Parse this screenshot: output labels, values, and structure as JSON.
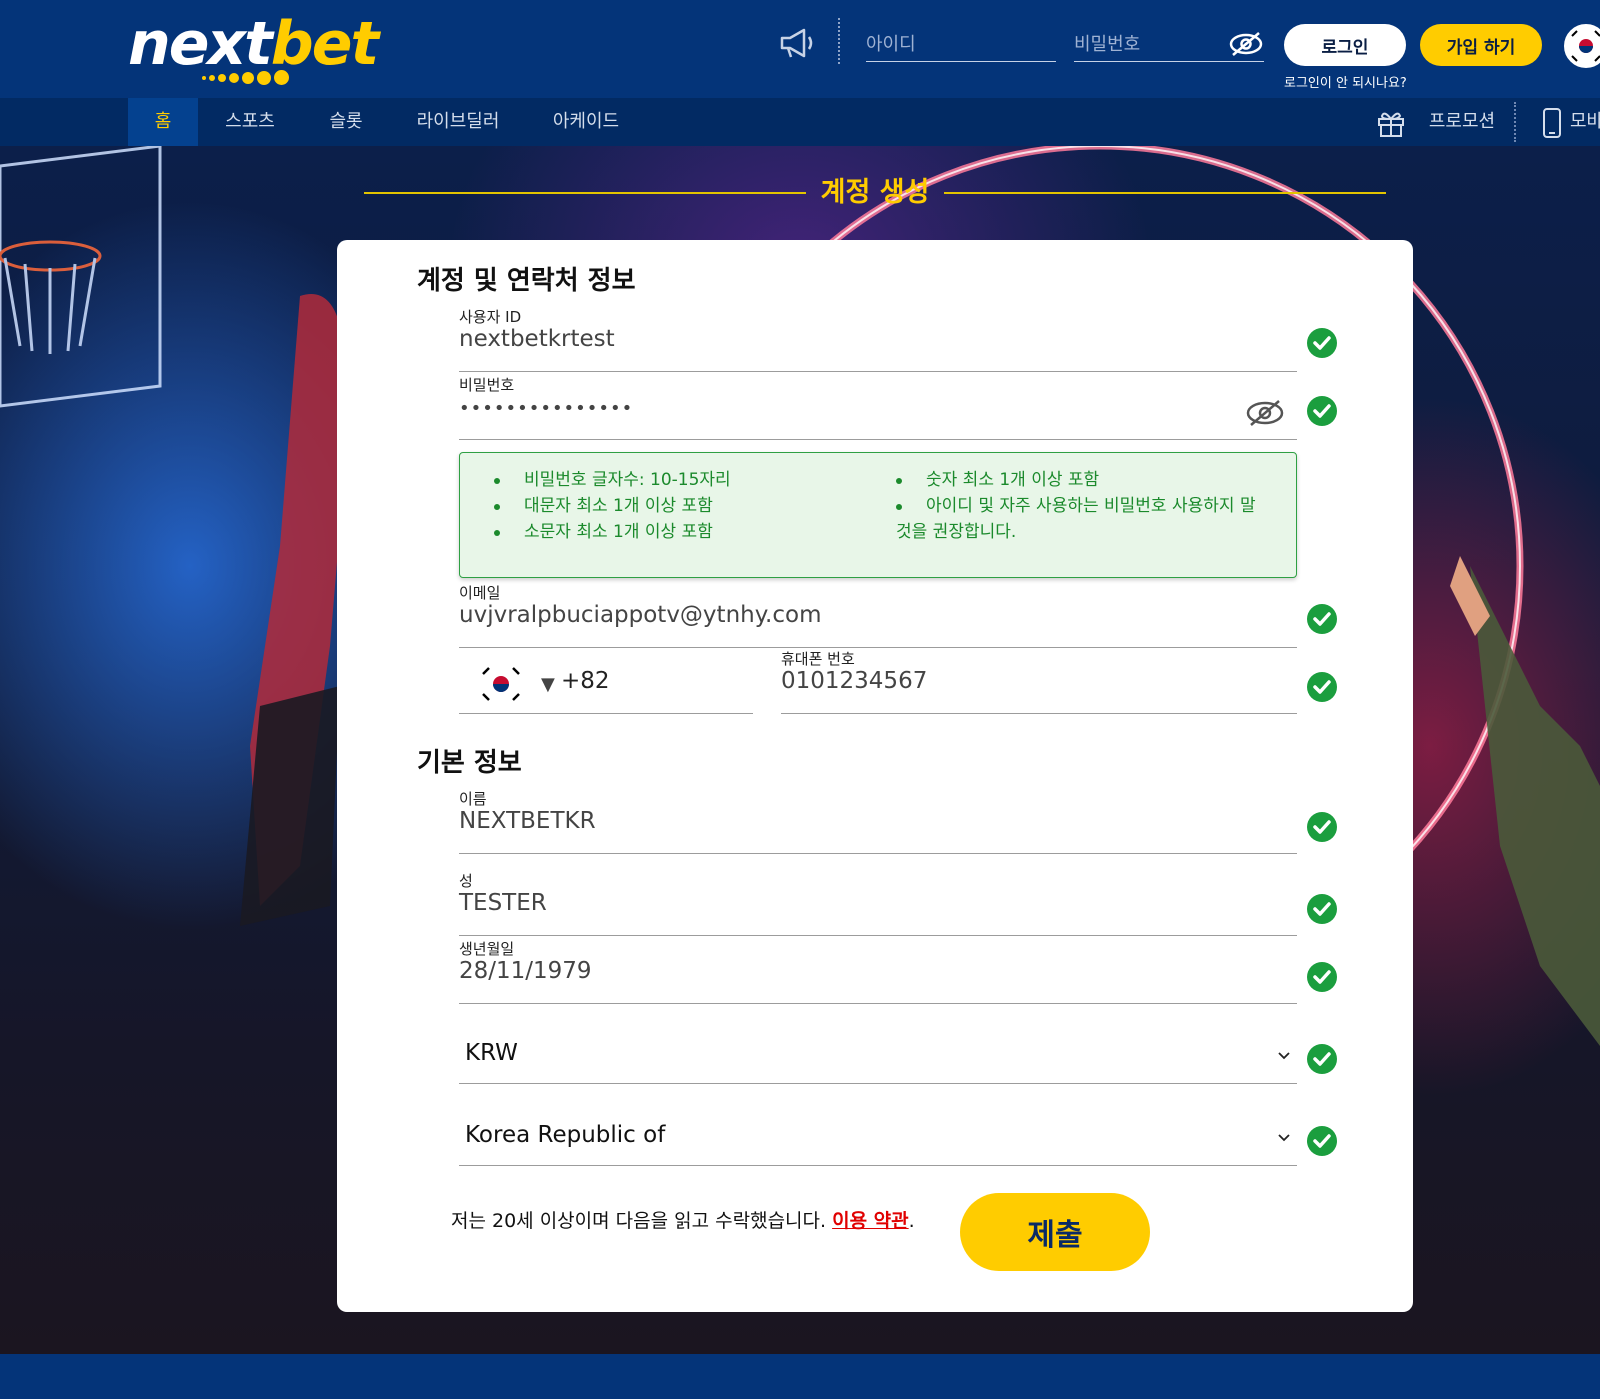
{
  "header": {
    "logo_next": "next",
    "logo_bet": "bet",
    "username_placeholder": "아이디",
    "password_placeholder": "비밀번호",
    "login_label": "로그인",
    "join_label": "가입 하기",
    "forgot_label": "로그인이 안 되시나요?"
  },
  "nav": {
    "items": [
      "홈",
      "스포츠",
      "슬롯",
      "라이브딜러",
      "아케이드"
    ],
    "promotion_label": "프로모션",
    "mobile_label": "모바"
  },
  "page": {
    "title": "계정 생성"
  },
  "account_section": {
    "title": "계정 및 연락처 정보",
    "user_id_label": "사용자 ID",
    "user_id_value": "nextbetkrtest",
    "password_label": "비밀번호",
    "password_value": "•••••••••••••••",
    "rules_col1": [
      "비밀번호 글자수: 10-15자리",
      "대문자 최소 1개 이상 포함",
      "소문자 최소 1개 이상 포함"
    ],
    "rules_col2_item1": "숫자 최소 1개 이상 포함",
    "rules_col2_item2_line1": "아이디 및 자주 사용하는 비밀번호 사용하지 말",
    "rules_col2_item2_line2": "것을 권장합니다.",
    "email_label": "이메일",
    "email_value": "uvjvralpbuciappotv@ytnhy.com",
    "phone_prefix": "+82",
    "phone_arrow": "▼",
    "phone_label": "휴대폰 번호",
    "phone_value": "0101234567"
  },
  "basic_section": {
    "title": "기본 정보",
    "first_name_label": "이름",
    "first_name_value": "NEXTBETKR",
    "last_name_label": "성",
    "last_name_value": "TESTER",
    "dob_label": "생년월일",
    "dob_value": "28/11/1979",
    "currency_value": "KRW",
    "country_value": "Korea Republic of"
  },
  "footer_form": {
    "terms_text": "저는 20세 이상이며 다음을 읽고 수락했습니다. ",
    "terms_link": "이용 약관",
    "terms_period": ".",
    "submit_label": "제출"
  },
  "colors": {
    "header_bg": "#043479",
    "accent_yellow": "#ffcc00",
    "success_green": "#1b8a2c",
    "link_red": "#e00000"
  }
}
